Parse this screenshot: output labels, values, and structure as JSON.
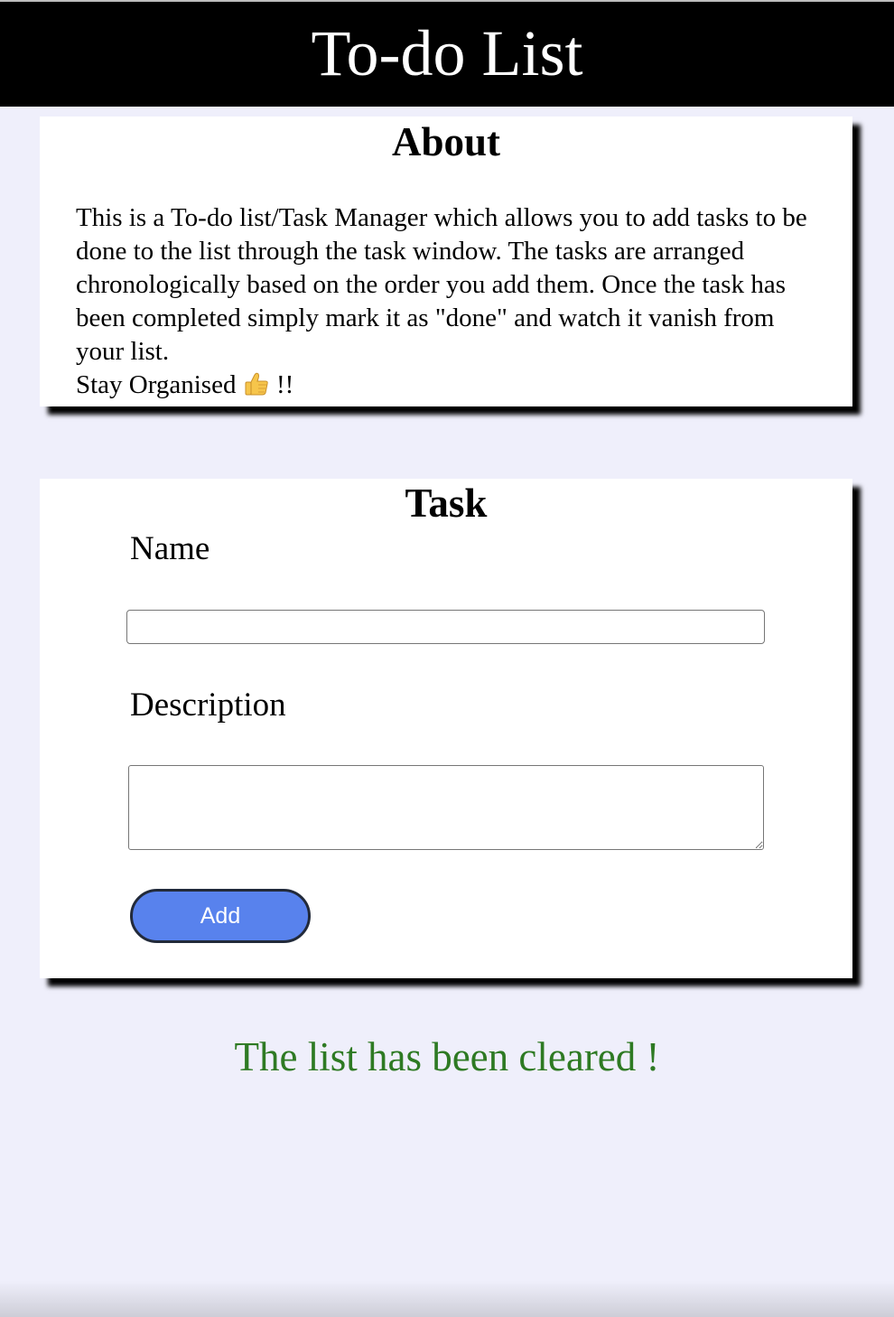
{
  "header": {
    "title": "To-do List"
  },
  "about": {
    "title": "About",
    "description": "This is a To-do list/Task Manager which allows you to add tasks to be done to the list through the task window. The tasks are arranged chronologically based on the order you add them. Once the task has been completed simply mark it as \"done\" and watch it vanish from your list.",
    "tagline_start": "Stay Organised",
    "tagline_end": "!!",
    "tagline_icon": "thumbs-up-icon"
  },
  "task_form": {
    "title": "Task",
    "name_label": "Name",
    "name_value": "",
    "description_label": "Description",
    "description_value": "",
    "add_label": "Add"
  },
  "status": {
    "message": "The list has been cleared !"
  },
  "colors": {
    "background": "#efeffb",
    "header": "#000000",
    "button": "#5882ed",
    "status_text": "#2e7a23"
  }
}
